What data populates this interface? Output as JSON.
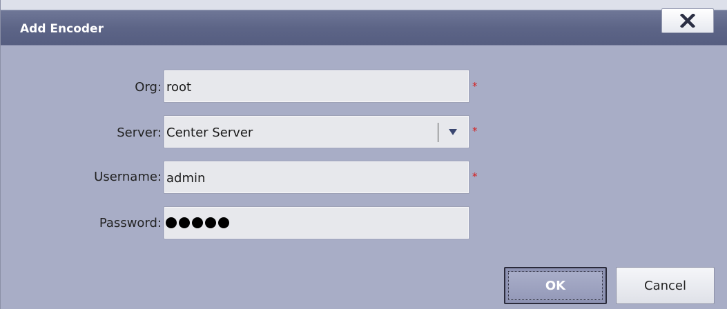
{
  "dialog": {
    "title": "Add Encoder",
    "close_icon": "close-x-icon"
  },
  "form": {
    "org": {
      "label": "Org:",
      "value": "root",
      "required_mark": "*"
    },
    "server": {
      "label": "Server:",
      "value": "Center Server",
      "required_mark": "*",
      "arrow_icon": "dropdown-triangle-icon"
    },
    "username": {
      "label": "Username:",
      "value": "admin",
      "required_mark": "*"
    },
    "password": {
      "label": "Password:",
      "masked_length": 5
    }
  },
  "buttons": {
    "ok_label": "OK",
    "cancel_label": "Cancel"
  },
  "colors": {
    "background": "#a8adc6",
    "titlebar": "#5d6587",
    "required": "#d42020"
  }
}
